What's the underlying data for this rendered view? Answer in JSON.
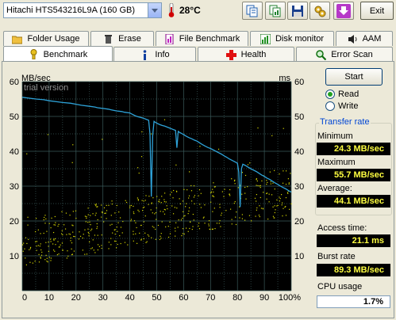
{
  "toolbar": {
    "drive": "Hitachi HTS543216L9A (160 GB)",
    "temperature": "28°C",
    "exit_label": "Exit",
    "buttons": [
      "copy-text-icon",
      "copy-info-icon",
      "save-icon",
      "options-icon",
      "download-icon"
    ]
  },
  "tabs_row1": [
    "Folder Usage",
    "Erase",
    "File Benchmark",
    "Disk monitor",
    "AAM"
  ],
  "tabs_row2": [
    "Benchmark",
    "Info",
    "Health",
    "Error Scan"
  ],
  "active_tab": "Benchmark",
  "chart_labels": {
    "left_unit": "MB/sec",
    "right_unit": "ms",
    "watermark": "trial version"
  },
  "controls": {
    "start_label": "Start",
    "read_label": "Read",
    "write_label": "Write",
    "selected_mode": "Read"
  },
  "stats": {
    "group_title": "Transfer rate",
    "minimum_label": "Minimum",
    "minimum_value": "24.3 MB/sec",
    "maximum_label": "Maximum",
    "maximum_value": "55.7 MB/sec",
    "average_label": "Average:",
    "average_value": "44.1 MB/sec",
    "access_label": "Access time:",
    "access_value": "21.1 ms",
    "burst_label": "Burst rate",
    "burst_value": "89.3 MB/sec",
    "cpu_label": "CPU usage",
    "cpu_value": "1.7%"
  },
  "colors": {
    "transfer_line": "#2ea3d9",
    "access_dots": "#d8d800",
    "grid": "#3a5a5a",
    "plot_bg": "#000000",
    "value_text": "#ffff40"
  },
  "chart_data": {
    "type": "scatter",
    "title": "",
    "xlabel": "",
    "ylabel": "MB/sec",
    "y2label": "ms",
    "x_ticks": [
      "0",
      "10",
      "20",
      "30",
      "40",
      "50",
      "60",
      "70",
      "80",
      "90",
      "100%"
    ],
    "y_ticks": [
      "10",
      "20",
      "30",
      "40",
      "50",
      "60"
    ],
    "xlim": [
      0,
      100
    ],
    "ylim": [
      0,
      60
    ],
    "y2lim": [
      0,
      60
    ],
    "grid": true,
    "series": [
      {
        "kind": "line",
        "x": [
          0,
          3,
          5,
          8,
          10,
          13,
          15,
          18,
          20,
          22,
          25,
          27,
          28,
          30,
          32,
          33,
          35,
          37,
          38,
          40,
          41,
          42,
          43,
          44,
          45,
          46,
          47,
          47.5,
          48,
          48.5,
          49,
          49.5,
          50,
          51,
          52,
          53,
          54,
          55,
          56,
          57,
          57.5,
          58,
          58.5,
          59,
          60,
          61,
          62,
          63,
          64,
          65,
          66,
          67,
          68,
          69,
          70,
          71,
          72,
          73,
          74,
          75,
          76,
          77,
          78,
          79,
          80,
          80.5,
          81,
          81.5,
          82,
          83,
          84,
          85,
          86,
          87,
          88,
          89,
          90,
          91,
          92,
          93,
          94,
          95,
          96,
          97,
          98,
          99,
          100
        ],
        "y": [
          55.5,
          55.2,
          55.0,
          54.8,
          54.5,
          54.2,
          54.0,
          53.8,
          53.5,
          53.2,
          52.9,
          52.7,
          52.5,
          52.3,
          52.1,
          51.9,
          51.6,
          51.4,
          51.2,
          51.0,
          50.6,
          50.2,
          49.9,
          49.7,
          49.5,
          49.2,
          48.9,
          45.0,
          27.0,
          44.5,
          48.6,
          48.3,
          48.1,
          47.7,
          47.4,
          47.2,
          46.9,
          46.6,
          46.3,
          46.0,
          41.0,
          45.7,
          45.4,
          45.2,
          44.8,
          44.3,
          43.9,
          43.6,
          43.2,
          42.9,
          42.4,
          41.9,
          41.5,
          41.1,
          40.8,
          40.4,
          40.0,
          39.6,
          39.2,
          38.7,
          38.3,
          37.8,
          37.4,
          37.0,
          36.6,
          34.0,
          24.0,
          35.0,
          36.3,
          35.9,
          35.4,
          35.0,
          34.6,
          34.2,
          33.7,
          33.2,
          32.8,
          32.3,
          31.9,
          31.4,
          30.9,
          30.5,
          30.0,
          29.6,
          29.2,
          28.7,
          28.3
        ]
      },
      {
        "kind": "scatter",
        "note_spread_ms": [
          12,
          30
        ],
        "trend_ms_start": 14,
        "trend_ms_end": 29
      }
    ]
  }
}
